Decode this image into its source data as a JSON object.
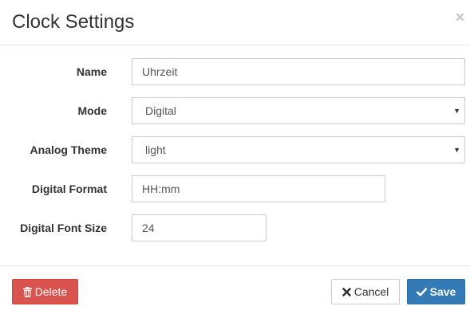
{
  "dialog": {
    "title": "Clock Settings",
    "close_label": "×"
  },
  "form": {
    "name": {
      "label": "Name",
      "value": "Uhrzeit"
    },
    "mode": {
      "label": "Mode",
      "value": "Digital"
    },
    "analog_theme": {
      "label": "Analog Theme",
      "value": "light"
    },
    "digital_format": {
      "label": "Digital Format",
      "value": "HH:mm"
    },
    "digital_font_size": {
      "label": "Digital Font Size",
      "value": "24"
    }
  },
  "footer": {
    "delete_label": "Delete",
    "cancel_label": "Cancel",
    "save_label": "Save"
  },
  "icons": {
    "delete": "trash-icon",
    "cancel": "x-icon",
    "save": "check-icon",
    "select": "caret-down-icon"
  },
  "colors": {
    "delete_bg": "#d9534f",
    "save_bg": "#337ab7",
    "border": "#cccccc"
  }
}
